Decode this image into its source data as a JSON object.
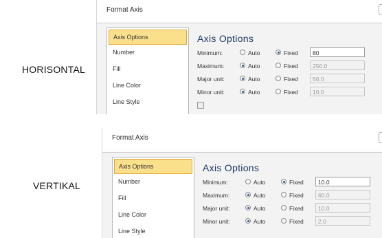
{
  "labels": {
    "horizontal": "HORISONTAL",
    "vertical": "VERTIKAL"
  },
  "dialogs": [
    {
      "title": "Format Axis",
      "categories": [
        "Axis Options",
        "Number",
        "Fill",
        "Line Color",
        "Line Style"
      ],
      "selected_category": "Axis Options",
      "panel_title": "Axis Options",
      "rows": [
        {
          "label": "Minimum:",
          "auto": "Auto",
          "fixed": "Fixed",
          "selected": "fixed",
          "value": "80"
        },
        {
          "label": "Maximum:",
          "auto": "Auto",
          "fixed": "Fixed",
          "selected": "auto",
          "value": "250.0"
        },
        {
          "label": "Major unit:",
          "auto": "Auto",
          "fixed": "Fixed",
          "selected": "auto",
          "value": "50.0"
        },
        {
          "label": "Minor unit:",
          "auto": "Auto",
          "fixed": "Fixed",
          "selected": "auto",
          "value": "10.0"
        }
      ]
    },
    {
      "title": "Format Axis",
      "categories": [
        "Axis Options",
        "Number",
        "Fill",
        "Line Color",
        "Line Style"
      ],
      "selected_category": "Axis Options",
      "panel_title": "Axis Options",
      "rows": [
        {
          "label": "Minimum:",
          "auto": "Auto",
          "fixed": "Fixed",
          "selected": "fixed",
          "value": "10.0"
        },
        {
          "label": "Maximum:",
          "auto": "Auto",
          "fixed": "Fixed",
          "selected": "auto",
          "value": "60.0"
        },
        {
          "label": "Major unit:",
          "auto": "Auto",
          "fixed": "Fixed",
          "selected": "auto",
          "value": "10.0"
        },
        {
          "label": "Minor unit:",
          "auto": "Auto",
          "fixed": "Fixed",
          "selected": "auto",
          "value": "2.0"
        }
      ]
    }
  ],
  "colors": {
    "selected_fill": "#fbe08c",
    "selected_border": "#e3a93c",
    "panel_title": "#1f3763"
  }
}
